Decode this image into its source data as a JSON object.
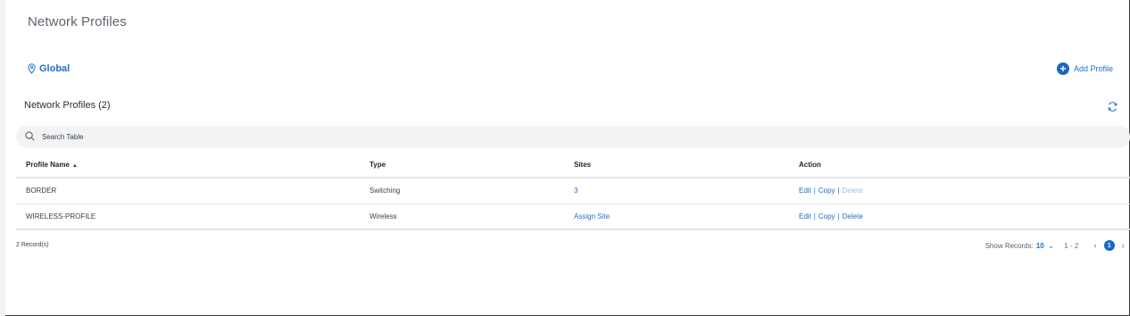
{
  "page": {
    "title": "Network Profiles"
  },
  "site": {
    "label": "Global",
    "icon": "location-pin-icon"
  },
  "actions": {
    "add_profile_label": "Add Profile",
    "add_icon": "plus-circle-icon",
    "refresh_icon": "refresh-icon"
  },
  "table_section": {
    "title": "Network Profiles (2)"
  },
  "search": {
    "placeholder": "Search Table",
    "value": ""
  },
  "table": {
    "columns": {
      "name": "Profile Name",
      "type": "Type",
      "sites": "Sites",
      "action": "Action"
    },
    "sort": {
      "column": "Profile Name",
      "direction": "ascending",
      "indicator": "▲"
    },
    "rows": [
      {
        "name": "BORDER",
        "type": "Switching",
        "sites": "3",
        "edit": "Edit",
        "copy": "Copy",
        "delete": "Delete",
        "delete_enabled": false
      },
      {
        "name": "WIRELESS-PROFILE",
        "type": "Wireless",
        "sites": "Assign Site",
        "edit": "Edit",
        "copy": "Copy",
        "delete": "Delete",
        "delete_enabled": true
      }
    ],
    "action_separator": "|"
  },
  "footer": {
    "records": "2 Record(s)",
    "show_records_label": "Show Records:",
    "page_size": "10",
    "range": "1 - 2",
    "current_page": "1",
    "prev_icon": "chevron-left-icon",
    "next_icon": "chevron-right-icon"
  },
  "colors": {
    "accent": "#1e70c8",
    "primary_button": "#1a66c9",
    "search_bg": "#f2f3f4",
    "disabled_link": "#9bbfe6"
  }
}
